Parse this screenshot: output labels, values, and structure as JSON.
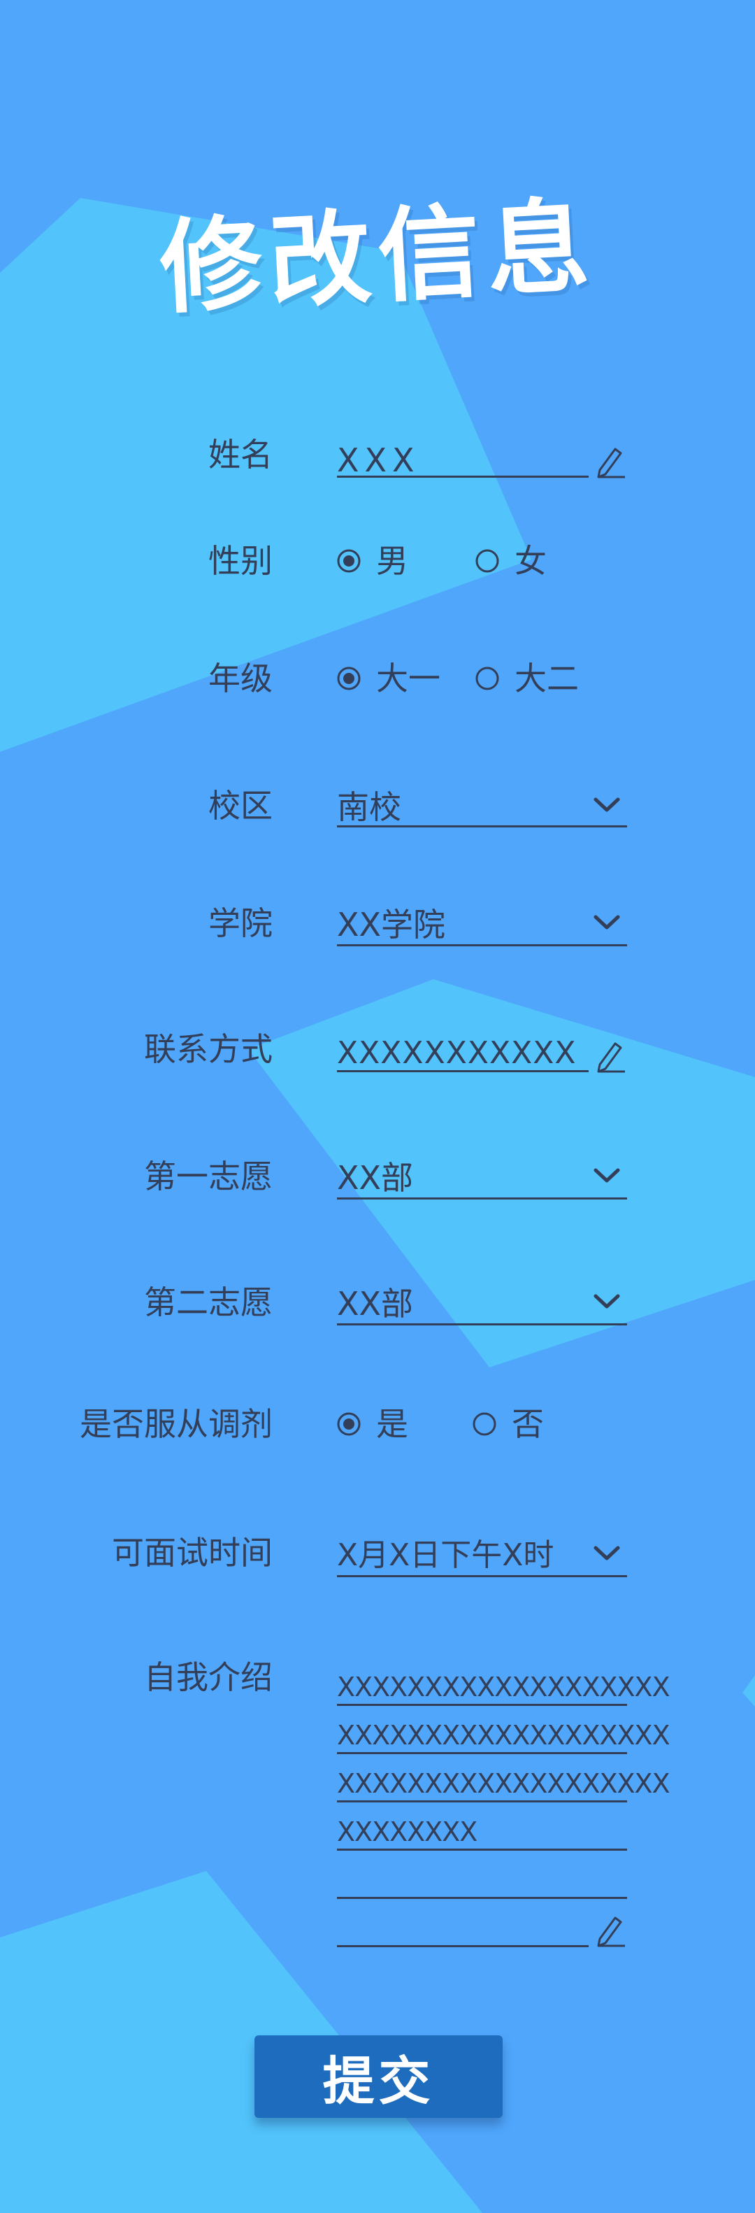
{
  "title": "修改信息",
  "form": {
    "name": {
      "label": "姓名",
      "value": "XXX"
    },
    "gender": {
      "label": "性别",
      "options": [
        "男",
        "女"
      ],
      "selected": "男"
    },
    "grade": {
      "label": "年级",
      "options": [
        "大一",
        "大二"
      ],
      "selected": "大一"
    },
    "campus": {
      "label": "校区",
      "value": "南校"
    },
    "college": {
      "label": "学院",
      "value": "XX学院"
    },
    "contact": {
      "label": "联系方式",
      "value": "XXXXXXXXXXX"
    },
    "first_choice": {
      "label": "第一志愿",
      "value": "XX部"
    },
    "second_choice": {
      "label": "第二志愿",
      "value": "XX部"
    },
    "adjust": {
      "label": "是否服从调剂",
      "options": [
        "是",
        "否"
      ],
      "selected": "是"
    },
    "interview_time": {
      "label": "可面试时间",
      "value": "X月X日下午X时"
    },
    "intro": {
      "label": "自我介绍",
      "lines": [
        "XXXXXXXXXXXXXXXXXXX",
        "XXXXXXXXXXXXXXXXXXX",
        "XXXXXXXXXXXXXXXXXXX",
        "XXXXXXXX",
        "",
        ""
      ]
    }
  },
  "submit_label": "提交",
  "colors": {
    "background": "#4fa6fb",
    "shape_light": "#52c3fb",
    "text": "#333e58",
    "button": "#1e6cbe",
    "title": "#ffffff"
  },
  "icons": [
    "pencil-icon",
    "chevron-down-icon",
    "radio-checked-icon",
    "radio-unchecked-icon"
  ]
}
